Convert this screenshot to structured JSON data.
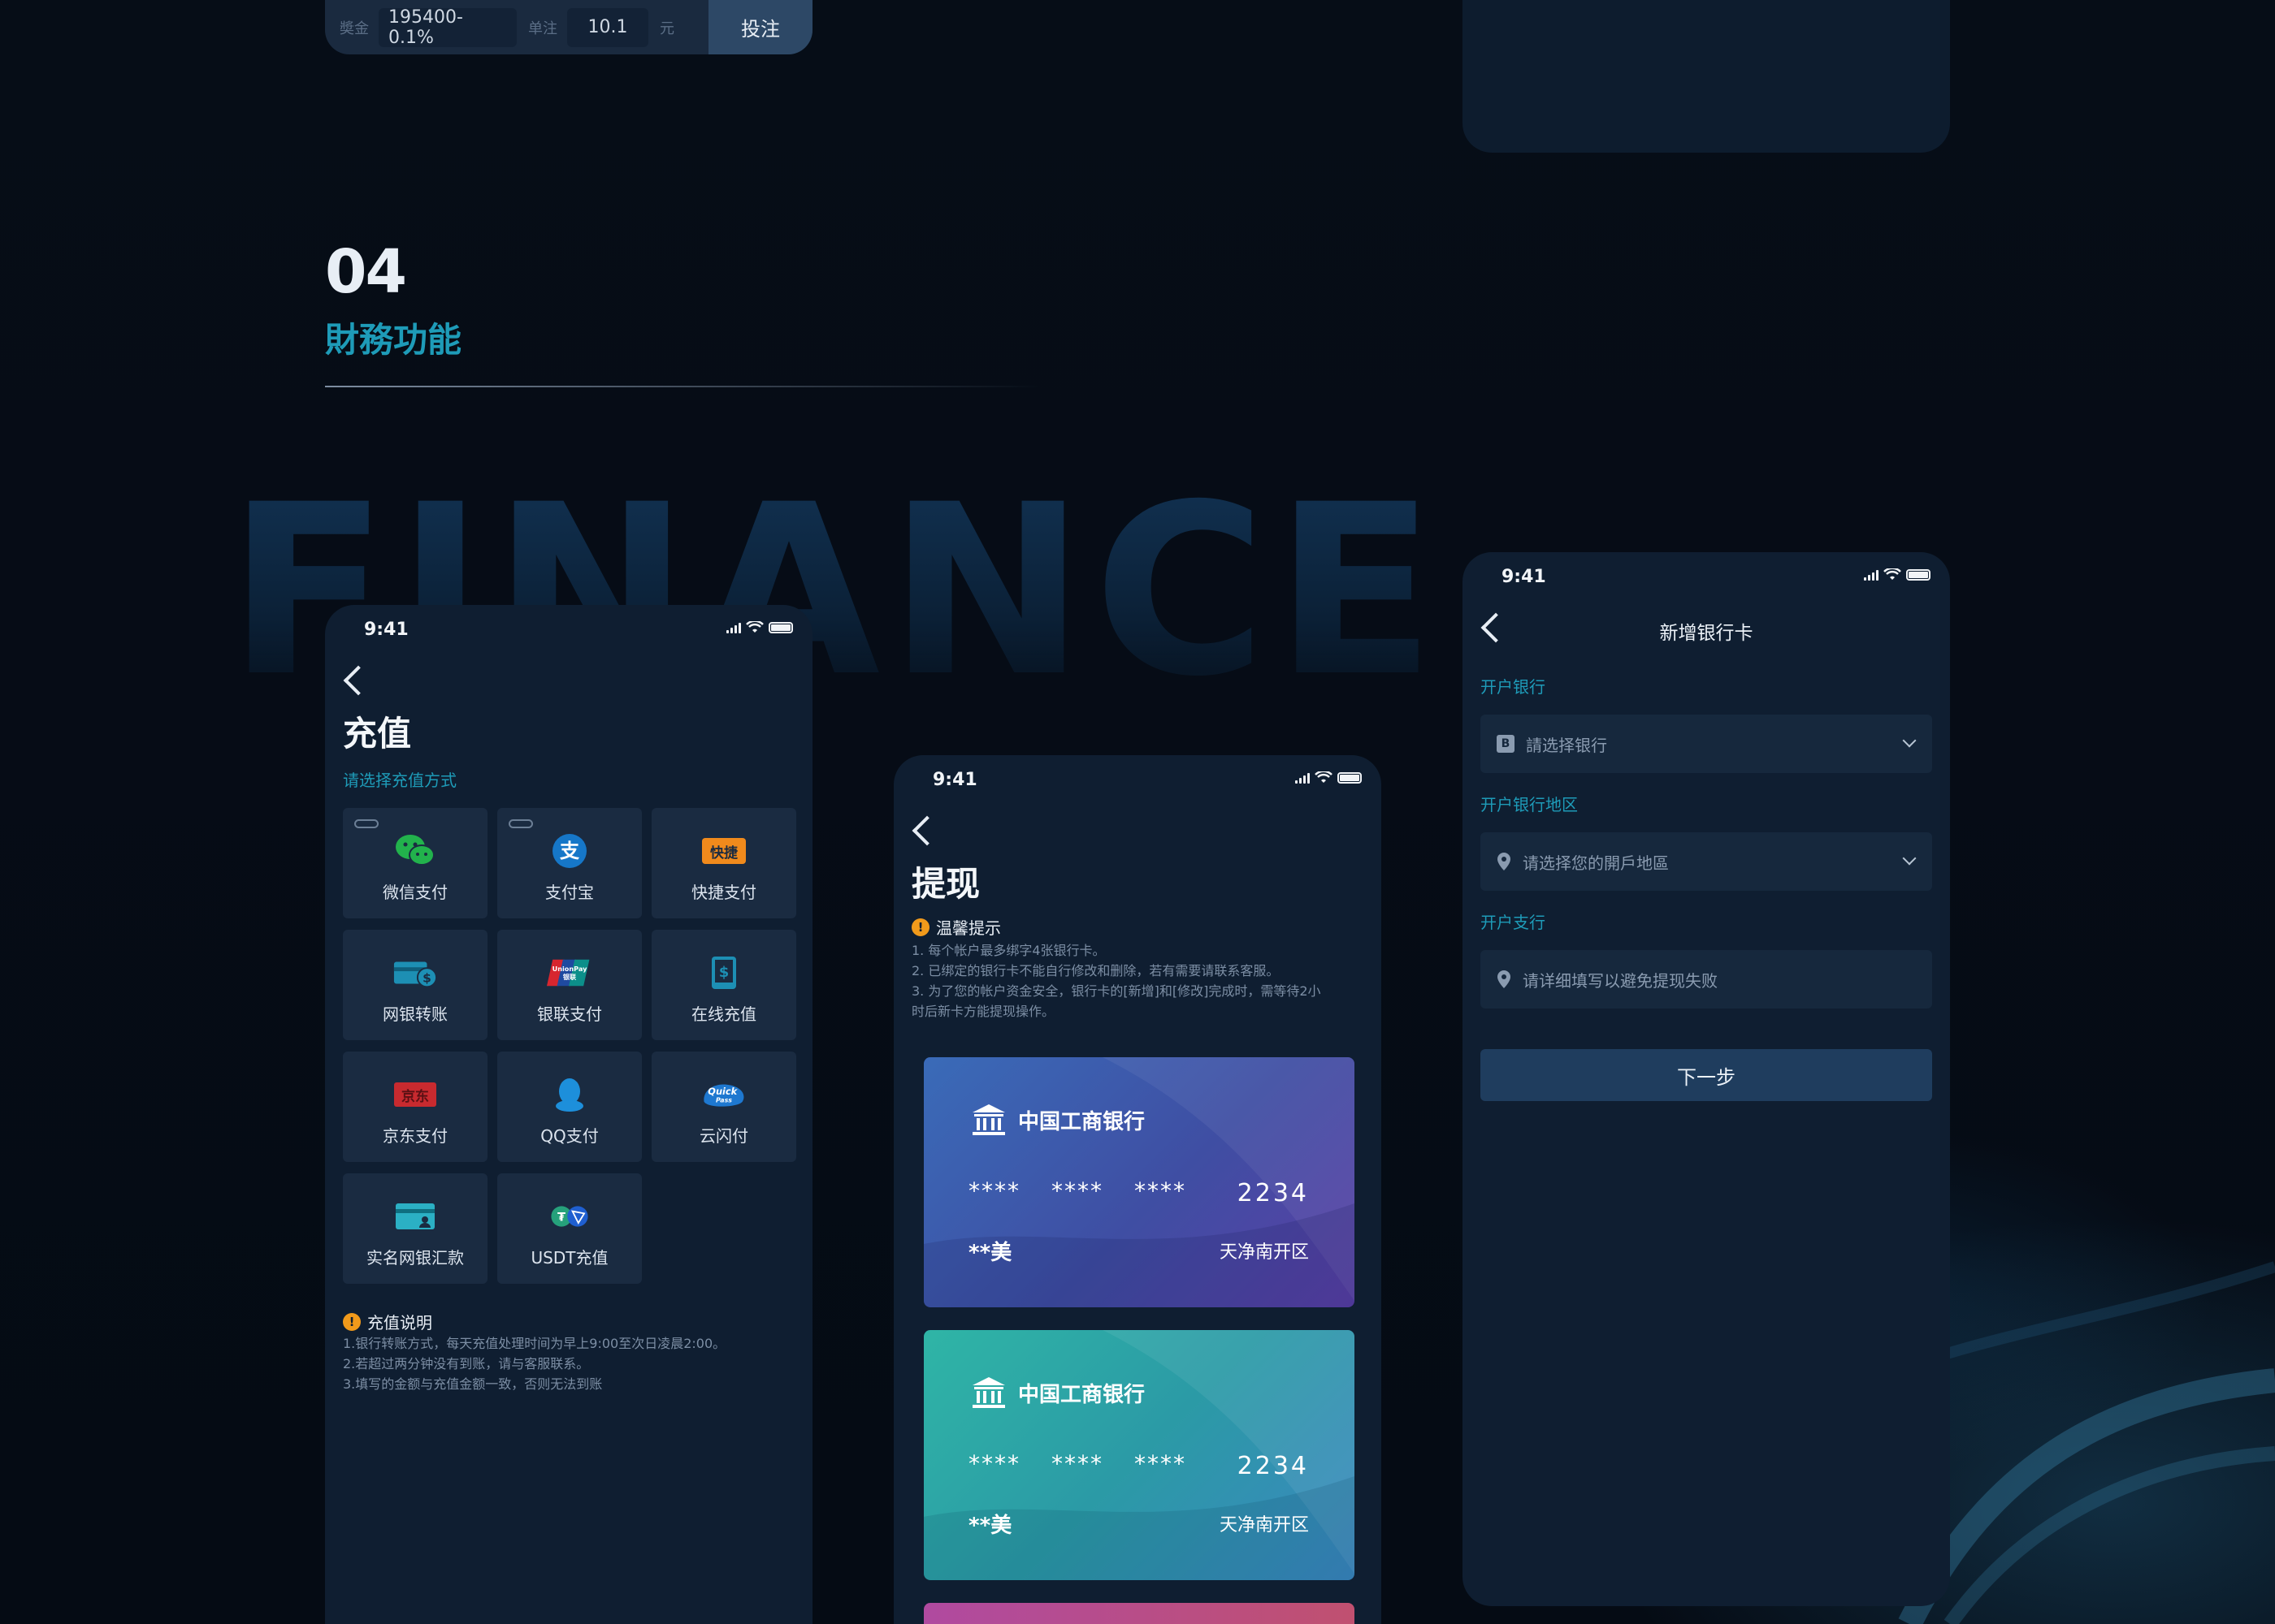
{
  "betbar": {
    "prize_label": "奬金",
    "prize_value": "195400-0.1%",
    "unit_label": "单注",
    "unit_value": "10.1",
    "currency": "元",
    "submit_label": "投注"
  },
  "section": {
    "number": "04",
    "title": "財務功能",
    "bg_word": "FINANCE"
  },
  "status": {
    "time": "9:41"
  },
  "recharge": {
    "title": "充值",
    "subtitle": "请选择充值方式",
    "methods": [
      {
        "label": "微信支付",
        "icon": "wechat-icon"
      },
      {
        "label": "支付宝",
        "icon": "alipay-icon"
      },
      {
        "label": "快捷支付",
        "icon": "quickpay-icon",
        "badge": "快捷"
      },
      {
        "label": "网银转账",
        "icon": "bank-transfer-icon"
      },
      {
        "label": "银联支付",
        "icon": "unionpay-icon"
      },
      {
        "label": "在线充值",
        "icon": "online-recharge-icon"
      },
      {
        "label": "京东支付",
        "icon": "jd-pay-icon",
        "badge": "京东"
      },
      {
        "label": "QQ支付",
        "icon": "qq-pay-icon"
      },
      {
        "label": "云闪付",
        "icon": "quickpass-icon"
      },
      {
        "label": "实名网银汇款",
        "icon": "realname-bank-icon"
      },
      {
        "label": "USDT充值",
        "icon": "usdt-icon"
      }
    ],
    "note_title": "充值说明",
    "notes": [
      "1.银行转账方式，每天充值处理时间为早上9:00至次日凌晨2:00。",
      "2.若超过两分钟没有到账，请与客服联系。",
      "3.填写的金额与充值金额一致，否则无法到账"
    ]
  },
  "withdraw": {
    "title": "提现",
    "tip_title": "温馨提示",
    "tips": [
      "1. 每个帐户最多绑字4张银行卡。",
      "2. 已绑定的银行卡不能自行修改和删除，若有需要请联系客服。",
      "3. 为了您的帐户资金安全，银行卡的[新增]和[修改]完成时，需等待2小",
      "时后新卡方能提现操作。"
    ],
    "cards": [
      {
        "bank": "中国工商银行",
        "mask": [
          "****",
          "****",
          "****"
        ],
        "tail": "2234",
        "holder": "**美",
        "area": "天净南开区"
      },
      {
        "bank": "中国工商银行",
        "mask": [
          "****",
          "****",
          "****"
        ],
        "tail": "2234",
        "holder": "**美",
        "area": "天净南开区"
      }
    ]
  },
  "addcard": {
    "title": "新增银行卡",
    "bank_label": "开户银行",
    "bank_placeholder": "請选择银行",
    "region_label": "开户银行地区",
    "region_placeholder": "请选择您的開戶地區",
    "branch_label": "开户支行",
    "branch_placeholder": "请详细填写以避免提现失败",
    "next_label": "下一步"
  },
  "colors": {
    "accent": "#1e9bb8",
    "warning": "#f19a1b",
    "card_blue": "#3d5fb0",
    "card_teal": "#2fa3a8"
  }
}
